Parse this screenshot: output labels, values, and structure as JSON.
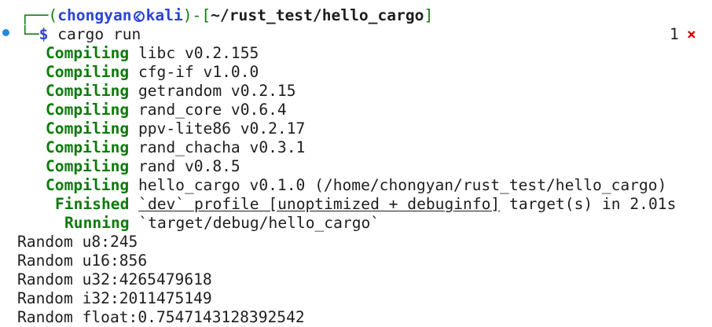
{
  "prompt": {
    "user": "chongyan",
    "host": "kali",
    "path": "~/rust_test/hello_cargo",
    "symbol": "$",
    "command": "cargo run",
    "exit_count": "1",
    "exit_mark": "×"
  },
  "compiling_label": "Compiling",
  "compile_lines": [
    "libc v0.2.155",
    "cfg-if v1.0.0",
    "getrandom v0.2.15",
    "rand_core v0.6.4",
    "ppv-lite86 v0.2.17",
    "rand_chacha v0.3.1",
    "rand v0.8.5",
    "hello_cargo v0.1.0 (/home/chongyan/rust_test/hello_cargo)"
  ],
  "finished": {
    "label": "Finished",
    "text": "`dev` profile [unoptimized + debuginfo]",
    "suffix": " target(s) in 2.01s"
  },
  "running": {
    "label": "Running",
    "text": "`target/debug/hello_cargo`"
  },
  "output_lines": [
    "Random u8:245",
    "Random u16:856",
    "Random u32:4265479618",
    "Random i32:2011475149",
    "Random float:0.7547143128392542"
  ],
  "colors": {
    "green": "#0e7a0d",
    "blue": "#2b44d6",
    "indicator": "#1f8bde",
    "error": "#d00000"
  }
}
